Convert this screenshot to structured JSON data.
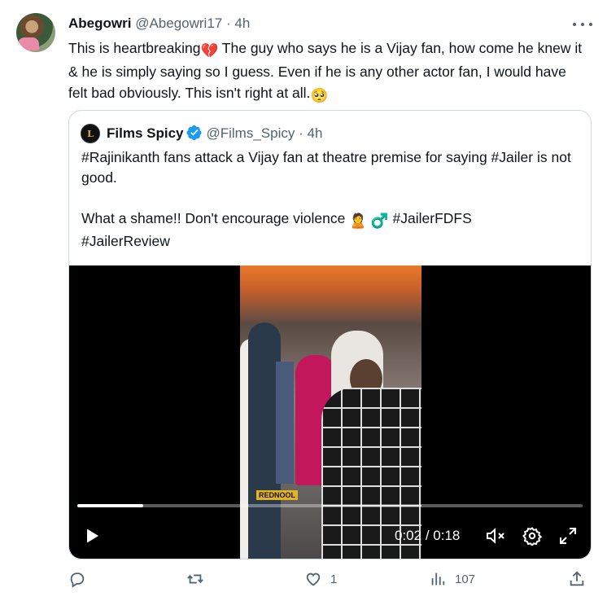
{
  "tweet": {
    "author_name": "Abegowri",
    "author_handle": "@Abegowri17",
    "separator": "·",
    "time": "4h",
    "text_part1": "This is heartbreaking",
    "text_part2": " The guy who says he is a Vijay fan, how come he knew it & he is simply saying so I guess. Even if he is any other actor fan, I would have felt bad obviously. This isn't right at all.",
    "emoji_broken_heart": "💔",
    "emoji_pleading": "🥺"
  },
  "quoted": {
    "author_name": "Films Spicy",
    "author_handle": "@Films_Spicy",
    "separator": "·",
    "time": "4h",
    "avatar_letter": "L",
    "text_line1": "#Rajinikanth fans attack a Vijay fan at theatre premise for saying #Jailer is not good.",
    "text_line2_before": "What a shame!! Don't encourage violence ",
    "emoji_person": "🙎",
    "emoji_male": "♂️",
    "text_line2_after": " #JailerFDFS",
    "text_line3": "#JailerReview",
    "video": {
      "watermark": "REDNOOL",
      "current_time": "0:02",
      "time_separator": " / ",
      "duration": "0:18",
      "progress_fraction": 0.13
    }
  },
  "actions": {
    "reply_count": "",
    "retweet_count": "",
    "like_count": "1",
    "views_count": "107"
  },
  "colors": {
    "verified_blue": "#1d9bf0",
    "secondary_text": "#536471",
    "border": "#cfd9de"
  }
}
